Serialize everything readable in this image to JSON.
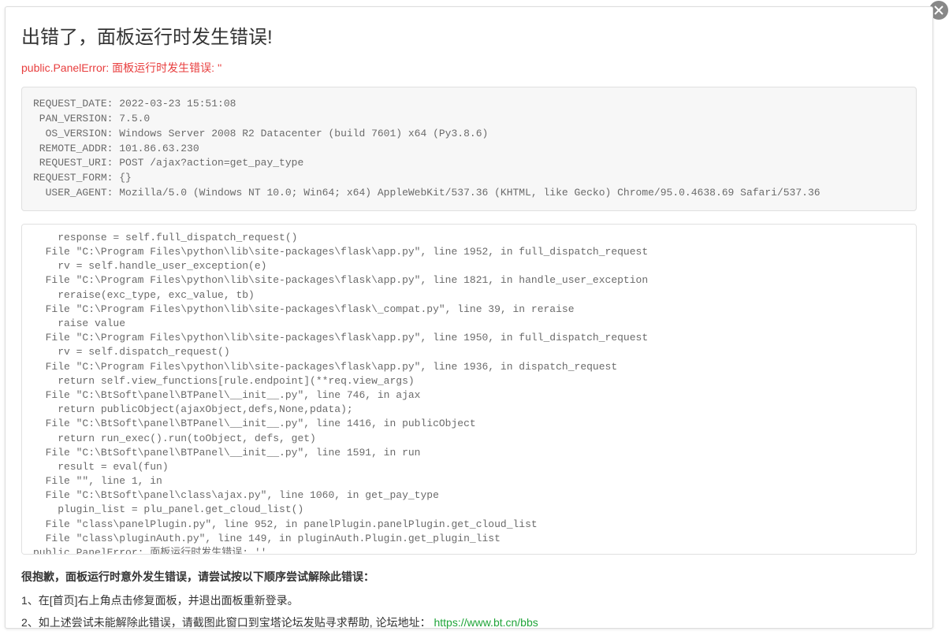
{
  "header": {
    "title": "出错了，面板运行时发生错误!",
    "error_line": "public.PanelError: 面板运行时发生错误: ''"
  },
  "request_info": "REQUEST_DATE: 2022-03-23 15:51:08\n PAN_VERSION: 7.5.0\n  OS_VERSION: Windows Server 2008 R2 Datacenter (build 7601) x64 (Py3.8.6)\n REMOTE_ADDR: 101.86.63.230\n REQUEST_URI: POST /ajax?action=get_pay_type\nREQUEST_FORM: {}\n  USER_AGENT: Mozilla/5.0 (Windows NT 10.0; Win64; x64) AppleWebKit/537.36 (KHTML, like Gecko) Chrome/95.0.4638.69 Safari/537.36\n",
  "traceback": "    response = self.full_dispatch_request()\n  File \"C:\\Program Files\\python\\lib\\site-packages\\flask\\app.py\", line 1952, in full_dispatch_request\n    rv = self.handle_user_exception(e)\n  File \"C:\\Program Files\\python\\lib\\site-packages\\flask\\app.py\", line 1821, in handle_user_exception\n    reraise(exc_type, exc_value, tb)\n  File \"C:\\Program Files\\python\\lib\\site-packages\\flask\\_compat.py\", line 39, in reraise\n    raise value\n  File \"C:\\Program Files\\python\\lib\\site-packages\\flask\\app.py\", line 1950, in full_dispatch_request\n    rv = self.dispatch_request()\n  File \"C:\\Program Files\\python\\lib\\site-packages\\flask\\app.py\", line 1936, in dispatch_request\n    return self.view_functions[rule.endpoint](**req.view_args)\n  File \"C:\\BtSoft\\panel\\BTPanel\\__init__.py\", line 746, in ajax\n    return publicObject(ajaxObject,defs,None,pdata);\n  File \"C:\\BtSoft\\panel\\BTPanel\\__init__.py\", line 1416, in publicObject\n    return run_exec().run(toObject, defs, get)\n  File \"C:\\BtSoft\\panel\\BTPanel\\__init__.py\", line 1591, in run\n    result = eval(fun)\n  File \"\", line 1, in \n  File \"C:\\BtSoft\\panel\\class\\ajax.py\", line 1060, in get_pay_type\n    plugin_list = plu_panel.get_cloud_list()\n  File \"class\\panelPlugin.py\", line 952, in panelPlugin.panelPlugin.get_cloud_list\n  File \"class\\pluginAuth.py\", line 149, in pluginAuth.Plugin.get_plugin_list\npublic.PanelError: 面板运行时发生错误: ''",
  "footer": {
    "heading": "很抱歉，面板运行时意外发生错误，请尝试按以下顺序尝试解除此错误：",
    "step1": "1、在[首页]右上角点击修复面板，并退出面板重新登录。",
    "step2_prefix": "2、如上述尝试未能解除此错误，请截图此窗口到宝塔论坛发贴寻求帮助, 论坛地址：",
    "step2_link_text": "https://www.bt.cn/bbs",
    "step2_link_href": "https://www.bt.cn/bbs"
  }
}
